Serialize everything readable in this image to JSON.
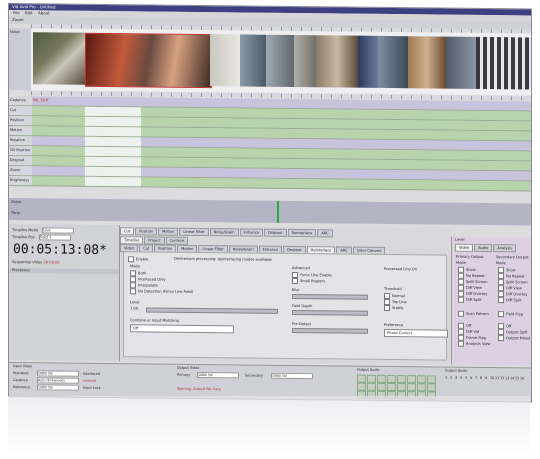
{
  "window": {
    "title": "Vid Avid Pro - Untitled"
  },
  "menu": [
    "File",
    "Edit",
    "About"
  ],
  "timeline": {
    "toolbar_label": "Zoom",
    "track_header_label": "Video",
    "track_names": [
      "Cadence",
      "Cut",
      "Position",
      "Motion",
      "Rotation",
      "2D Position",
      "Dropout",
      "Zoom",
      "Brightness"
    ],
    "cadence_value": "PAL EDIT"
  },
  "scroll": {
    "left_label": "Zoom",
    "right_label": "Time"
  },
  "left_panel": {
    "timeline_mode_label": "Timeline Mode",
    "timeline_mode_value": "Live",
    "timeline_pos_label": "Timeline Pos",
    "timeline_pos_value": "Field 1",
    "timecode": "00:05:13:08*",
    "status_label": "Sequential Video",
    "status_value": "00:00:00",
    "section_title": "Processes"
  },
  "center_panel": {
    "top_tabs": [
      "Cut",
      "Position",
      "Motion",
      "Linear Filter",
      "Noise/Grain",
      "Enhance",
      "Dropout",
      "Deinterlace",
      "ARC"
    ],
    "sub_tabs": [
      "Timeline",
      "Project",
      "Controls"
    ],
    "inner_tabs": [
      "Video",
      "Cut",
      "Position",
      "Motion",
      "Linear Filter",
      "Noise/Grain",
      "Enhance",
      "Dropout",
      "Deinterlace",
      "ARC",
      "Color Convert"
    ],
    "enable_label": "Enable",
    "note": "Deinterlace processing: deinterlacing modes available",
    "mode_label": "Mode",
    "options": [
      "Both",
      "Interlaced Only",
      "Interpolate",
      "No Detection (Force Line Field)"
    ],
    "level_label": "Level",
    "level_value": "1.00",
    "combine_label": "Combine or Input Matching",
    "combine_value": "Off",
    "advanced_label": "Advanced",
    "advanced_options": [
      "Force Line Enable",
      "Small Regions"
    ],
    "blur_label": "Blur",
    "field_depth_label": "Field Depth",
    "pre_detect_label": "Pre-Detect",
    "threshold_label": "Threshold",
    "threshold_options": [
      "Normal",
      "Top Line",
      "Stable"
    ],
    "prefer_label": "Preference",
    "prefer_value": "Phase Correct",
    "output_note": "Processed Line On"
  },
  "right_panel": {
    "title": "Level",
    "tabs": [
      "Video",
      "Audio",
      "Analysis"
    ],
    "primary_label": "Primary Output",
    "secondary_label": "Secondary Output",
    "mode_label": "Mode",
    "items": [
      "Show",
      "No Repeat",
      "Split Screen",
      "Diff View",
      "Diff Overlay",
      "Diff Split"
    ],
    "scan_label": "Scan Pattern",
    "field_flag_label": "Field Flag",
    "dual_options": [
      "Off",
      "Diff Vid",
      "Frame Flag",
      "Analysis View"
    ],
    "output_split_options": [
      "Off",
      "Output Split",
      "Output Mixed"
    ]
  },
  "bottom": {
    "input_title": "Input Video",
    "standard_label": "Standard",
    "standard_value": "1080i 50i",
    "cadence_label": "Cadence",
    "cadence_value": "Auto (Enhanced)",
    "reference_label": "Reference",
    "reference_value": "1080i 50i",
    "ib_label": "Interlaced",
    "ib_value": "Internal",
    "lock_label": "Input Lock",
    "output_title": "Output Video",
    "primary_label": "Primary",
    "primary_value": "1080i 50i",
    "secondary_label": "Secondary",
    "secondary_value": "1080i 50i",
    "warning": "Warning: Output PAL Rate",
    "gpi_title": "Output Audio",
    "meter_title": "Output Audio",
    "meter_labels": [
      "1",
      "2",
      "3",
      "4",
      "5",
      "6",
      "7",
      "8",
      "9",
      "10",
      "11",
      "12",
      "13",
      "14",
      "15",
      "16"
    ]
  }
}
